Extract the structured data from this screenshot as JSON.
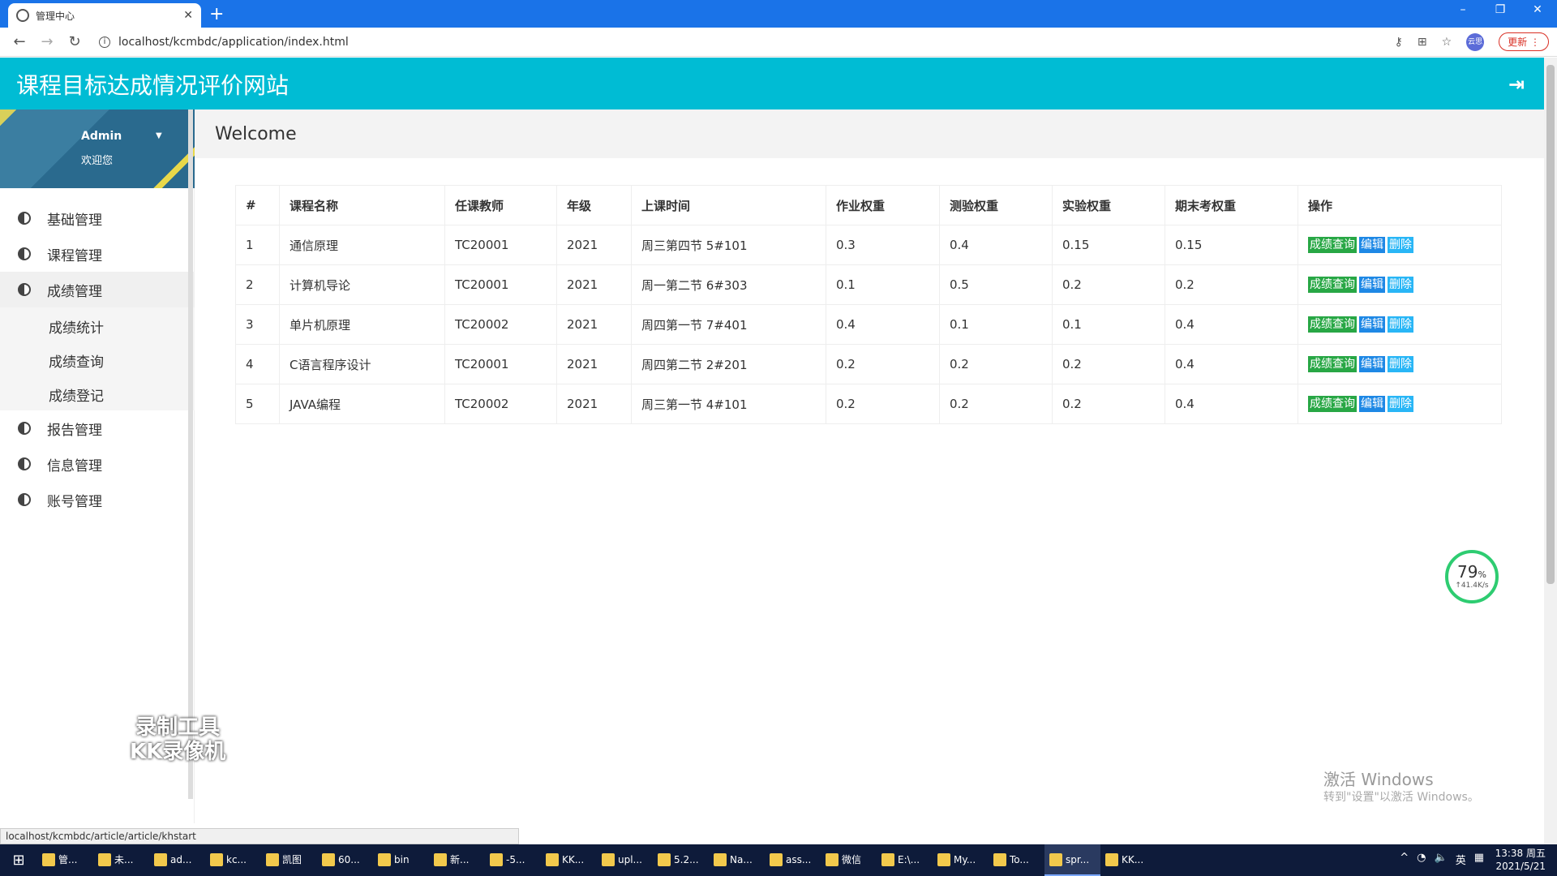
{
  "browser": {
    "tab_title": "管理中心",
    "url": "localhost/kcmbdc/application/index.html",
    "update_label": "更新",
    "avatar_text": "云思"
  },
  "app": {
    "title": "课程目标达成情况评价网站"
  },
  "user": {
    "name": "Admin",
    "greeting": "欢迎您"
  },
  "sidebar": {
    "items": [
      {
        "label": "基础管理"
      },
      {
        "label": "课程管理"
      },
      {
        "label": "成绩管理"
      },
      {
        "label": "报告管理"
      },
      {
        "label": "信息管理"
      },
      {
        "label": "账号管理"
      }
    ],
    "subitems": [
      {
        "label": "成绩统计"
      },
      {
        "label": "成绩查询"
      },
      {
        "label": "成绩登记"
      }
    ]
  },
  "main": {
    "welcome": "Welcome",
    "table": {
      "headers": [
        "#",
        "课程名称",
        "任课教师",
        "年级",
        "上课时间",
        "作业权重",
        "测验权重",
        "实验权重",
        "期末考权重",
        "操作"
      ],
      "rows": [
        [
          "1",
          "通信原理",
          "TC20001",
          "2021",
          "周三第四节 5#101",
          "0.3",
          "0.4",
          "0.15",
          "0.15"
        ],
        [
          "2",
          "计算机导论",
          "TC20001",
          "2021",
          "周一第二节 6#303",
          "0.1",
          "0.5",
          "0.2",
          "0.2"
        ],
        [
          "3",
          "单片机原理",
          "TC20002",
          "2021",
          "周四第一节 7#401",
          "0.4",
          "0.1",
          "0.1",
          "0.4"
        ],
        [
          "4",
          "C语言程序设计",
          "TC20001",
          "2021",
          "周四第二节 2#201",
          "0.2",
          "0.2",
          "0.2",
          "0.4"
        ],
        [
          "5",
          "JAVA编程",
          "TC20002",
          "2021",
          "周三第一节 4#101",
          "0.2",
          "0.2",
          "0.2",
          "0.4"
        ]
      ],
      "actions": [
        "成绩查询",
        "编辑",
        "删除"
      ]
    }
  },
  "overlay": {
    "net_percent": "79",
    "net_percent_unit": "%",
    "net_speed": "↑41.4K/s",
    "watermark_line1": "录制工具",
    "watermark_line2": "KK录像机",
    "activate_title": "激活 Windows",
    "activate_sub": "转到\"设置\"以激活 Windows。",
    "status_url": "localhost/kcmbdc/article/article/khstart"
  },
  "taskbar": {
    "items": [
      "管...",
      "未...",
      "ad...",
      "kc...",
      "凯图",
      "60...",
      "bin",
      "新...",
      "-5...",
      "KK...",
      "upl...",
      "5.2...",
      "Na...",
      "ass...",
      "微信",
      "E:\\...",
      "My...",
      "To...",
      "spr...",
      "KK..."
    ],
    "ime": "英",
    "time": "13:38 周五",
    "date": "2021/5/21"
  },
  "colors": {
    "header": "#00bcd4",
    "btn_query": "#28a745",
    "btn_edit": "#1e88e5",
    "btn_delete": "#29b6f6"
  }
}
